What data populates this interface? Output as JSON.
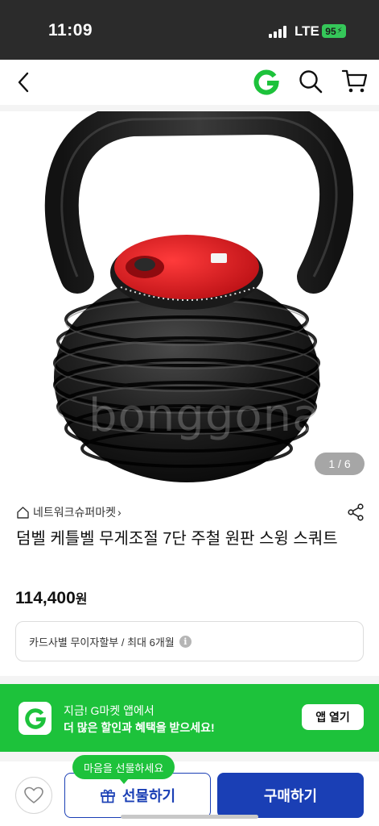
{
  "status_bar": {
    "time": "11:09",
    "network": "LTE",
    "battery": "95"
  },
  "nav": {
    "back_icon": "chevron-left-icon",
    "logo_letter": "G",
    "search_icon": "search-icon",
    "cart_icon": "cart-icon",
    "logo_color": "#1dc23b"
  },
  "product": {
    "image_counter": "1 / 6",
    "watermark": "bonggonam",
    "store_name": "네트워크슈퍼마켓",
    "title": "덤벨 케틀벨 무게조절 7단 주철 원판 스윙 스쿼트",
    "price_value": "114,400",
    "price_unit": "원",
    "installment": "카드사별 무이자할부 / 최대 6개월",
    "installment_info_icon": "i"
  },
  "app_banner": {
    "line1": "지금! G마켓 앱에서",
    "line2": "더 많은 할인과 혜택을 받으세요!",
    "button": "앱 열기",
    "color": "#1dc23b"
  },
  "bottom_bar": {
    "tooltip": "마음을 선물하세요",
    "gift_label": "선물하기",
    "buy_label": "구매하기",
    "accent": "#1a3fb5"
  }
}
